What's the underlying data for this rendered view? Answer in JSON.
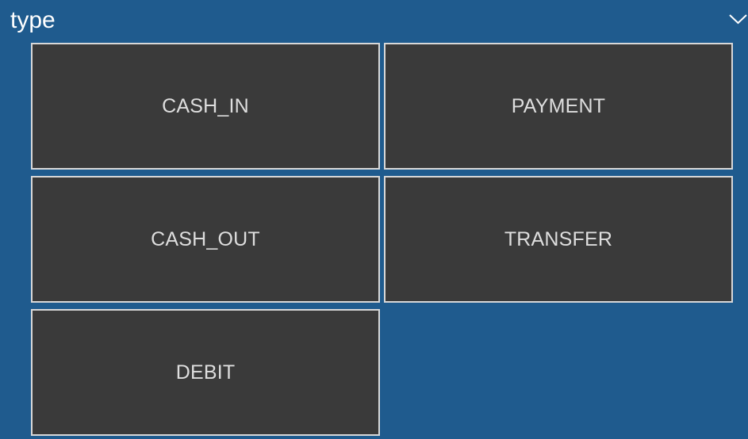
{
  "header": {
    "title": "type",
    "collapse_icon": "chevron-down-icon"
  },
  "tiles": [
    {
      "label": "CASH_IN"
    },
    {
      "label": "PAYMENT"
    },
    {
      "label": "CASH_OUT"
    },
    {
      "label": "TRANSFER"
    },
    {
      "label": "DEBIT"
    }
  ],
  "colors": {
    "background": "#1f5b8e",
    "tile_fill": "#3a3a3a",
    "tile_border": "#d8d8d8",
    "tile_text": "#dedede",
    "title_text": "#ffffff"
  }
}
